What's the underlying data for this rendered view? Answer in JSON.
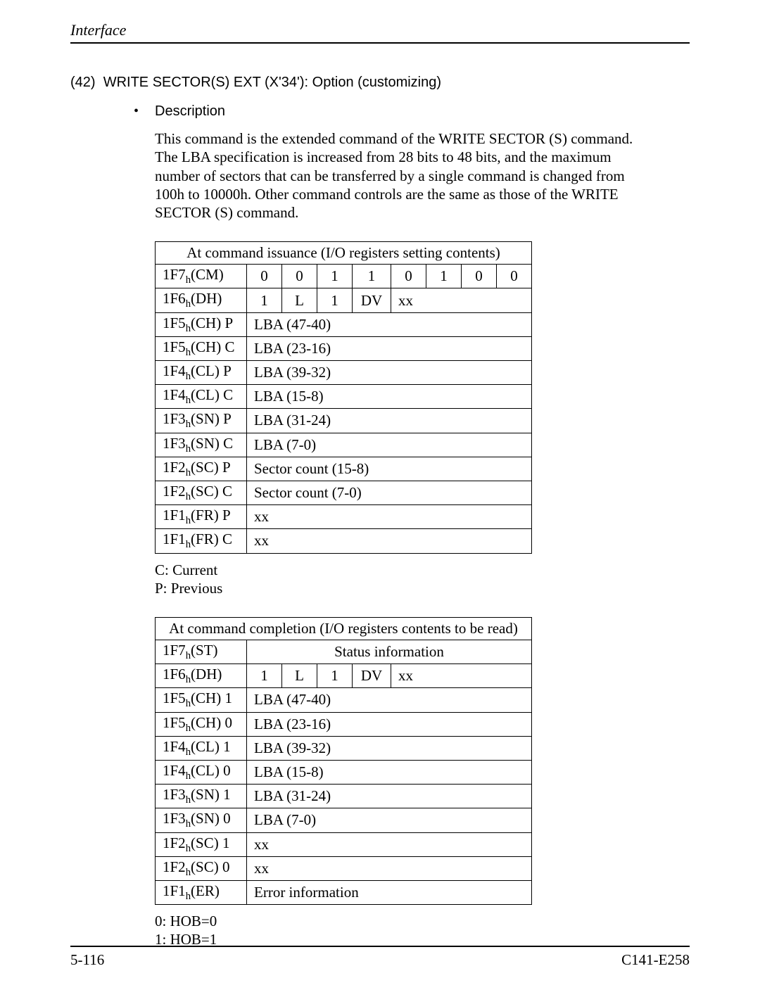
{
  "header": {
    "title": "Interface"
  },
  "section": {
    "number": "(42)",
    "title": "WRITE SECTOR(S) EXT (X'34'):  Option (customizing)",
    "bullet_label": "Description",
    "body": "This command is the extended command of the WRITE SECTOR (S) command. The LBA specification is increased from 28 bits to 48 bits, and the maximum number of sectors that can be transferred by a single command is changed from 100h to 10000h.  Other command controls are the same as those of the WRITE SECTOR (S) command."
  },
  "table1": {
    "caption": "At command issuance (I/O registers setting contents)",
    "row_cm": {
      "label": "1F7",
      "sub": "h",
      "paren": "(CM)",
      "bits": [
        "0",
        "0",
        "1",
        "1",
        "0",
        "1",
        "0",
        "0"
      ]
    },
    "row_dh": {
      "label": "1F6",
      "sub": "h",
      "paren": "(DH)",
      "c0": "1",
      "c1": "L",
      "c2": "1",
      "c3": "DV",
      "c4": "xx"
    },
    "rows": [
      {
        "label": "1F5",
        "sub": "h",
        "paren": "(CH) P",
        "val": "LBA (47-40)"
      },
      {
        "label": "1F5",
        "sub": "h",
        "paren": "(CH) C",
        "val": "LBA (23-16)"
      },
      {
        "label": "1F4",
        "sub": "h",
        "paren": "(CL) P",
        "val": "LBA (39-32)"
      },
      {
        "label": "1F4",
        "sub": "h",
        "paren": "(CL) C",
        "val": "LBA (15-8)"
      },
      {
        "label": "1F3",
        "sub": "h",
        "paren": "(SN) P",
        "val": "LBA (31-24)"
      },
      {
        "label": "1F3",
        "sub": "h",
        "paren": "(SN) C",
        "val": "LBA (7-0)"
      },
      {
        "label": "1F2",
        "sub": "h",
        "paren": "(SC) P",
        "val": "Sector count (15-8)"
      },
      {
        "label": "1F2",
        "sub": "h",
        "paren": "(SC) C",
        "val": "Sector count (7-0)"
      },
      {
        "label": "1F1",
        "sub": "h",
        "paren": "(FR) P",
        "val": "xx"
      },
      {
        "label": "1F1",
        "sub": "h",
        "paren": "(FR) C",
        "val": "xx"
      }
    ],
    "legend1": "C:  Current",
    "legend2": "P:  Previous"
  },
  "table2": {
    "caption": "At command completion (I/O registers contents to be read)",
    "row_st": {
      "label": "1F7",
      "sub": "h",
      "paren": "(ST)",
      "val": "Status information"
    },
    "row_dh": {
      "label": "1F6",
      "sub": "h",
      "paren": "(DH)",
      "c0": "1",
      "c1": "L",
      "c2": "1",
      "c3": "DV",
      "c4": "xx"
    },
    "rows": [
      {
        "label": "1F5",
        "sub": "h",
        "paren": "(CH) 1",
        "val": "LBA (47-40)"
      },
      {
        "label": "1F5",
        "sub": "h",
        "paren": "(CH) 0",
        "val": "LBA (23-16)"
      },
      {
        "label": "1F4",
        "sub": "h",
        "paren": "(CL) 1",
        "val": "LBA (39-32)"
      },
      {
        "label": "1F4",
        "sub": "h",
        "paren": "(CL) 0",
        "val": "LBA (15-8)"
      },
      {
        "label": "1F3",
        "sub": "h",
        "paren": "(SN) 1",
        "val": "LBA (31-24)"
      },
      {
        "label": "1F3",
        "sub": "h",
        "paren": "(SN) 0",
        "val": "LBA (7-0)"
      },
      {
        "label": "1F2",
        "sub": "h",
        "paren": "(SC) 1",
        "val": "xx"
      },
      {
        "label": "1F2",
        "sub": "h",
        "paren": "(SC) 0",
        "val": "xx"
      },
      {
        "label": "1F1",
        "sub": "h",
        "paren": "(ER)",
        "val": "Error information"
      }
    ],
    "legend1": "0:  HOB=0",
    "legend2": "1:  HOB=1"
  },
  "footer": {
    "left": "5-116",
    "right": "C141-E258"
  }
}
